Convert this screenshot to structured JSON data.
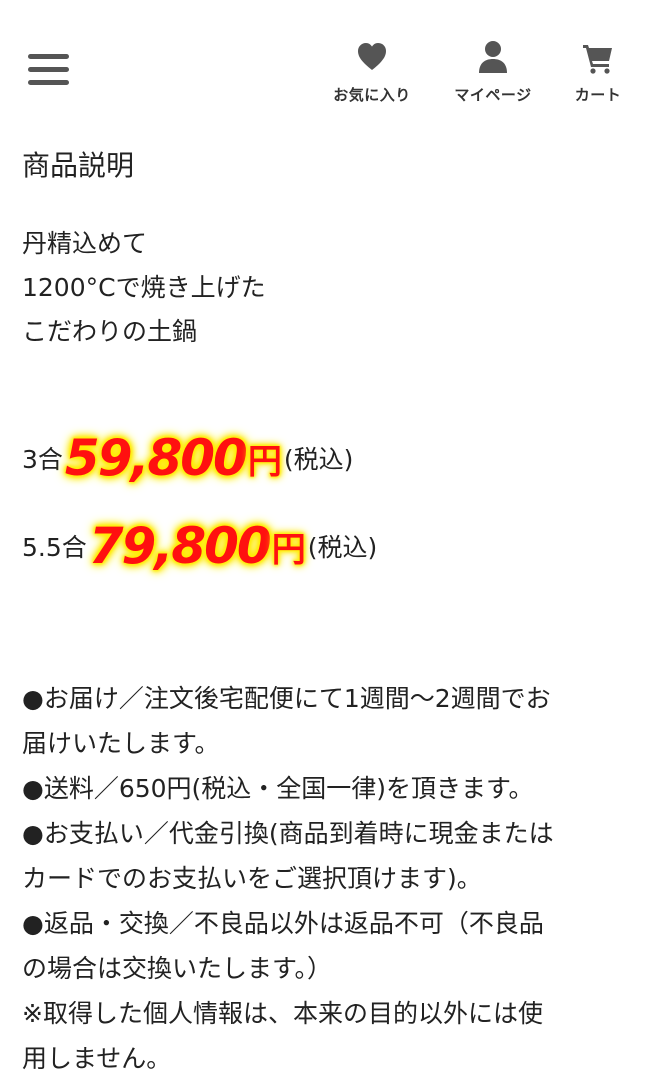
{
  "header": {
    "nav": [
      {
        "label": "お気に入り",
        "icon": "heart-icon"
      },
      {
        "label": "マイページ",
        "icon": "user-icon"
      },
      {
        "label": "カート",
        "icon": "cart-icon"
      }
    ]
  },
  "content": {
    "title": "商品説明",
    "intro_lines": [
      "丹精込めて",
      "1200°Cで焼き上げた",
      "こだわりの土鍋"
    ],
    "prices": [
      {
        "size": "3合",
        "amount": "59,800",
        "yen": "円",
        "tax": "(税込)"
      },
      {
        "size": "5.5合 ",
        "amount": "79,800",
        "yen": "円",
        "tax": "(税込)"
      }
    ],
    "notes": [
      "●お届け／注文後宅配便にて1週間〜2週間でお",
      "届けいたします。",
      "●送料／650円(税込・全国一律)を頂きます。",
      "●お支払い／代金引換(商品到着時に現金または",
      "カードでのお支払いをご選択頂けます)。",
      "●返品・交換／不良品以外は返品不可（不良品",
      "の場合は交換いたします。）",
      "※取得した個人情報は、本来の目的以外には使",
      "用しません。"
    ]
  },
  "colors": {
    "price_red": "#ff1010",
    "price_glow": "#ffee00",
    "icon_gray": "#555555",
    "text": "#222222"
  }
}
